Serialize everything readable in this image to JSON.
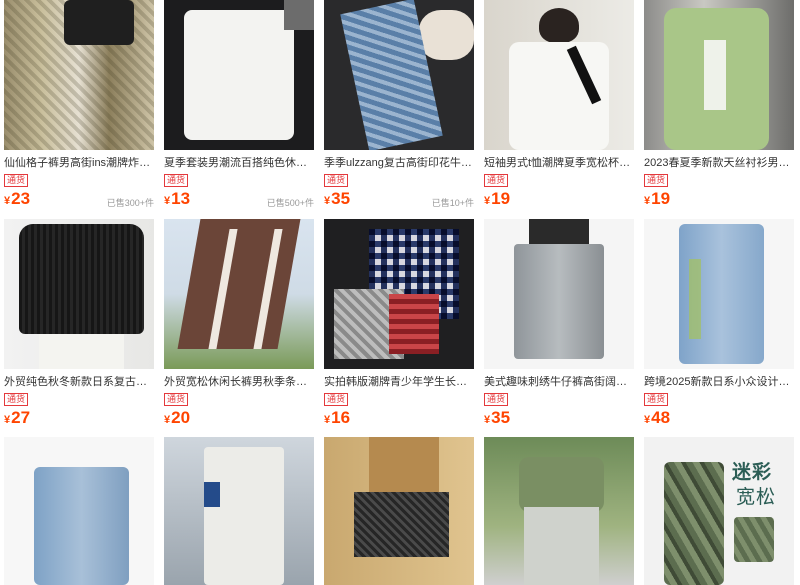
{
  "products": [
    {
      "title": "仙仙格子裤男高街ins潮牌炸街...",
      "tag": "通货",
      "currency": "¥",
      "price": "23",
      "sold": "已售300+件"
    },
    {
      "title": "夏季套装男潮流百搭纯色休闲...",
      "tag": "通货",
      "currency": "¥",
      "price": "13",
      "sold": "已售500+件"
    },
    {
      "title": "季季ulzzang复古高街印花牛仔...",
      "tag": "通货",
      "currency": "¥",
      "price": "35",
      "sold": "已售10+件"
    },
    {
      "title": "短袖男式t恤潮牌夏季宽松杯条...",
      "tag": "通货",
      "currency": "¥",
      "price": "19",
      "sold": ""
    },
    {
      "title": "2023春夏季新款天丝衬衫男款...",
      "tag": "通货",
      "currency": "¥",
      "price": "19",
      "sold": ""
    },
    {
      "title": "外贸纯色秋冬新款日系复古宽...",
      "tag": "通货",
      "currency": "¥",
      "price": "27",
      "sold": ""
    },
    {
      "title": "外贸宽松休闲长裤男秋季条纹...",
      "tag": "通货",
      "currency": "¥",
      "price": "20",
      "sold": ""
    },
    {
      "title": "实拍韩版潮牌青少年学生长袖...",
      "tag": "通货",
      "currency": "¥",
      "price": "16",
      "sold": ""
    },
    {
      "title": "美式趣味刺绣牛仔裤高街阔的百...",
      "tag": "通货",
      "currency": "¥",
      "price": "35",
      "sold": ""
    },
    {
      "title": "跨境2025新款日系小众设计刺...",
      "tag": "通货",
      "currency": "¥",
      "price": "48",
      "sold": ""
    },
    {
      "title": "",
      "tag": "",
      "currency": "",
      "price": "",
      "sold": ""
    },
    {
      "title": "",
      "tag": "",
      "currency": "",
      "price": "",
      "sold": ""
    },
    {
      "title": "",
      "tag": "",
      "currency": "",
      "price": "",
      "sold": ""
    },
    {
      "title": "",
      "tag": "",
      "currency": "",
      "price": "",
      "sold": ""
    },
    {
      "title": "",
      "tag": "",
      "currency": "",
      "price": "",
      "sold": ""
    }
  ],
  "banner": {
    "line1": "迷彩",
    "line2": "宽松"
  },
  "colors": {
    "price": "#ff4400",
    "tag": "#e4393c"
  }
}
